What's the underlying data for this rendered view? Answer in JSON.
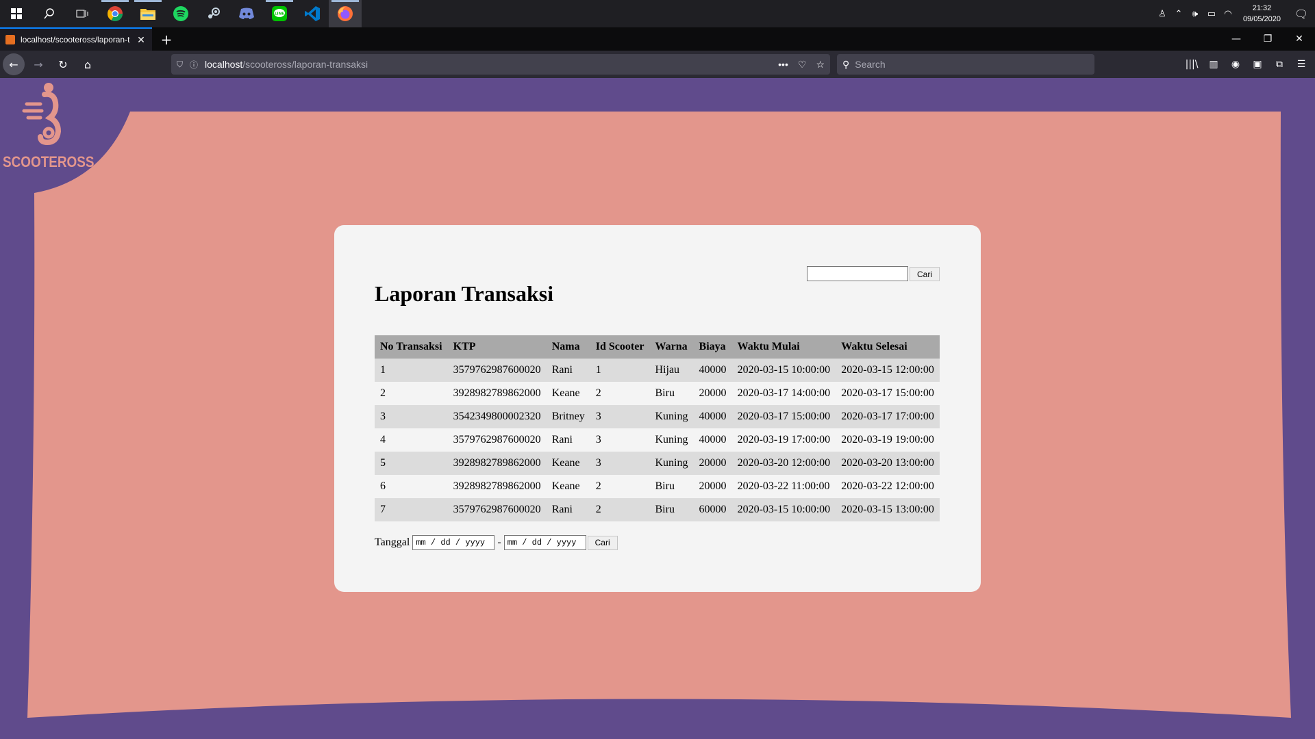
{
  "taskbar": {
    "start_icon": "windows-logo-icon",
    "search_icon": "search-icon",
    "taskview_icon": "task-view-icon",
    "apps": [
      "chrome",
      "file-explorer",
      "spotify",
      "steam",
      "discord",
      "line",
      "vscode",
      "firefox"
    ],
    "clock_time": "21:32",
    "clock_date": "09/05/2020"
  },
  "browser": {
    "tab_title": "localhost/scooteross/laporan-t",
    "url_host": "localhost",
    "url_path": "/scooteross/laporan-transaksi",
    "search_placeholder": "Search"
  },
  "logo": {
    "text": "SCOOTEROSS"
  },
  "report": {
    "title": "Laporan Transaksi",
    "search_button": "Cari",
    "columns": [
      "No Transaksi",
      "KTP",
      "Nama",
      "Id Scooter",
      "Warna",
      "Biaya",
      "Waktu Mulai",
      "Waktu Selesai"
    ],
    "rows": [
      [
        "1",
        "3579762987600020",
        "Rani",
        "1",
        "Hijau",
        "40000",
        "2020-03-15 10:00:00",
        "2020-03-15 12:00:00"
      ],
      [
        "2",
        "3928982789862000",
        "Keane",
        "2",
        "Biru",
        "20000",
        "2020-03-17 14:00:00",
        "2020-03-17 15:00:00"
      ],
      [
        "3",
        "3542349800002320",
        "Britney",
        "3",
        "Kuning",
        "40000",
        "2020-03-17 15:00:00",
        "2020-03-17 17:00:00"
      ],
      [
        "4",
        "3579762987600020",
        "Rani",
        "3",
        "Kuning",
        "40000",
        "2020-03-19 17:00:00",
        "2020-03-19 19:00:00"
      ],
      [
        "5",
        "3928982789862000",
        "Keane",
        "3",
        "Kuning",
        "20000",
        "2020-03-20 12:00:00",
        "2020-03-20 13:00:00"
      ],
      [
        "6",
        "3928982789862000",
        "Keane",
        "2",
        "Biru",
        "20000",
        "2020-03-22 11:00:00",
        "2020-03-22 12:00:00"
      ],
      [
        "7",
        "3579762987600020",
        "Rani",
        "2",
        "Biru",
        "60000",
        "2020-03-15 10:00:00",
        "2020-03-15 13:00:00"
      ]
    ],
    "date_label": "Tanggal",
    "date_placeholder_from": "mm / dd / yyyy",
    "date_separator": "-",
    "date_placeholder_to": "mm / dd / yyyy",
    "date_button": "Cari"
  },
  "colors": {
    "page_bg": "#604b8c",
    "salmon": "#e3968c",
    "card_bg": "#f4f4f4",
    "table_header": "#a9a9a9",
    "row_alt": "#dcdcdc"
  }
}
